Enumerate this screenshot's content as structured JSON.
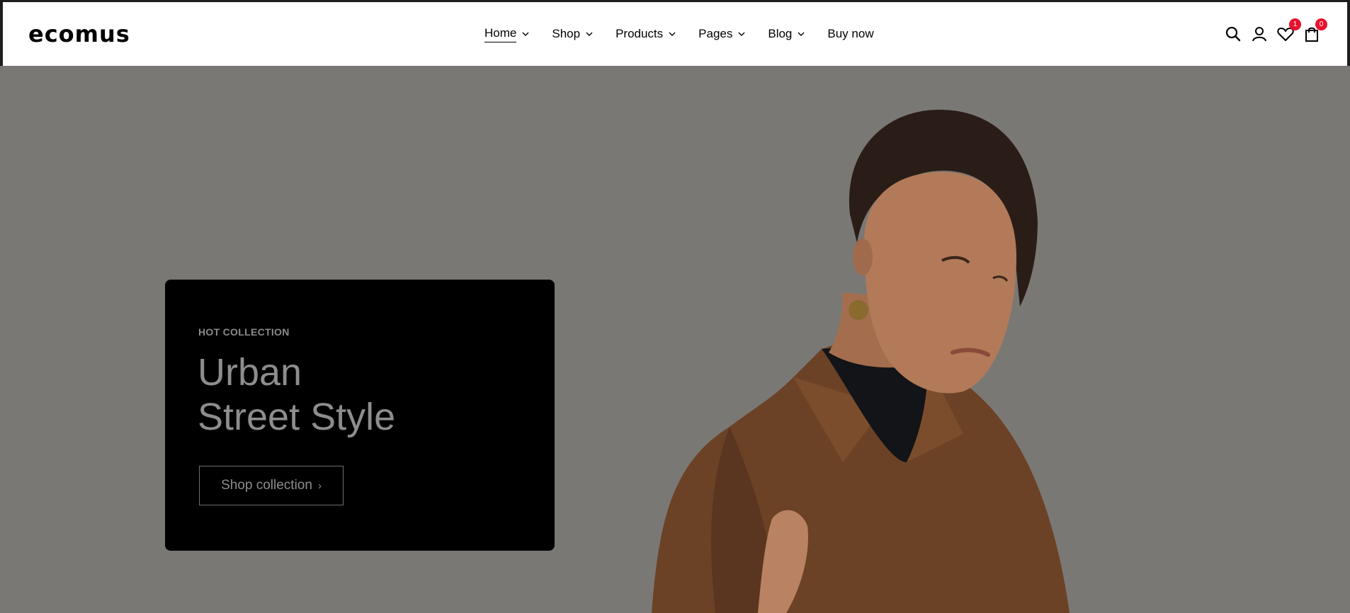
{
  "header": {
    "logo": "ecomus",
    "nav": [
      {
        "label": "Home",
        "dropdown": true,
        "active": true
      },
      {
        "label": "Shop",
        "dropdown": true
      },
      {
        "label": "Products",
        "dropdown": true
      },
      {
        "label": "Pages",
        "dropdown": true
      },
      {
        "label": "Blog",
        "dropdown": true
      },
      {
        "label": "Buy now",
        "dropdown": false
      }
    ],
    "icons": {
      "search": "search-icon",
      "account": "user-icon",
      "wishlist": "heart-icon",
      "cart": "bag-icon"
    },
    "wishlist_count": "1",
    "cart_count": "0"
  },
  "hero": {
    "eyebrow": "HOT COLLECTION",
    "headline_line1": "Urban",
    "headline_line2": "Street Style",
    "cta_label": "Shop collection",
    "cta_arrow": "›"
  },
  "colors": {
    "badge": "#e8112d",
    "overlay": "#7a7875",
    "card": "#000000"
  }
}
